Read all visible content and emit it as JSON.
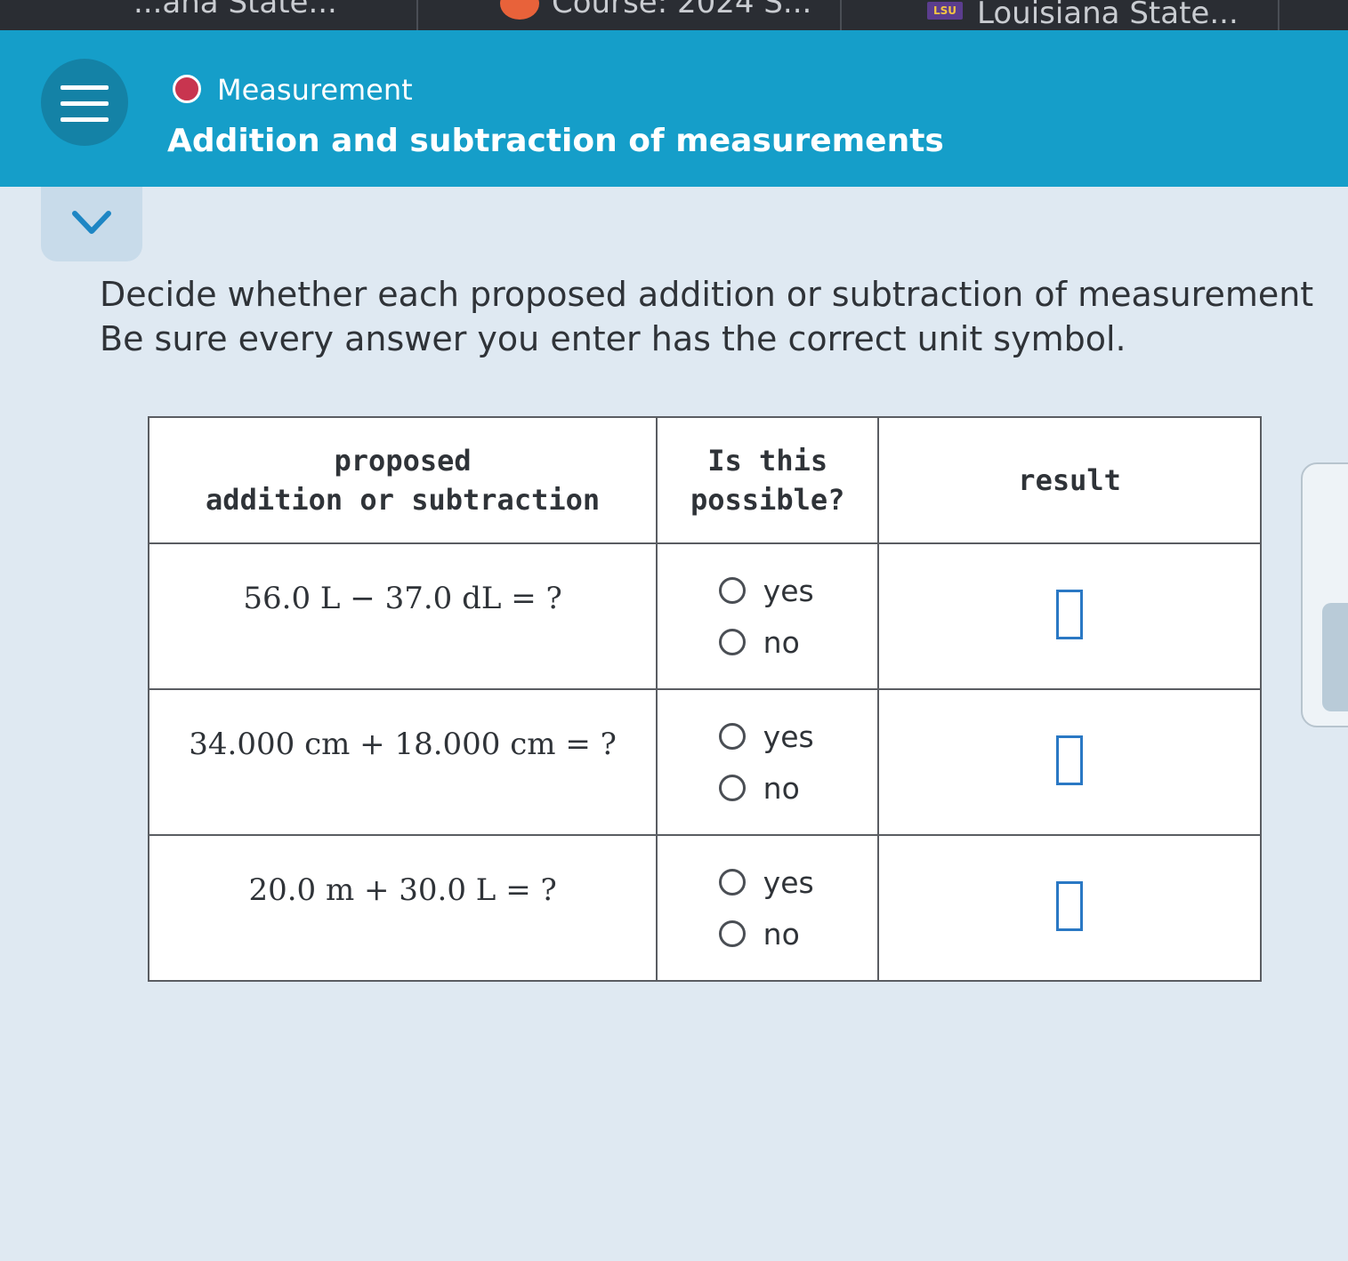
{
  "browser_tabs": [
    {
      "label": "...ana State..."
    },
    {
      "label": "Course: 2024 S..."
    },
    {
      "label": "Louisiana State...",
      "icon_text": "LSU"
    }
  ],
  "header": {
    "topic": "Measurement",
    "title": "Addition and subtraction of measurements"
  },
  "instructions": {
    "line1": "Decide whether each proposed addition or subtraction of measurement",
    "line2": "Be sure every answer you enter has the correct unit symbol."
  },
  "table": {
    "headers": {
      "col1_line1": "proposed",
      "col1_line2": "addition or subtraction",
      "col2_line1": "Is this",
      "col2_line2": "possible?",
      "col3": "result"
    },
    "rows": [
      {
        "expression": "56.0 L − 37.0 dL = ?",
        "option_yes": "yes",
        "option_no": "no"
      },
      {
        "expression": "34.000 cm + 18.000 cm = ?",
        "option_yes": "yes",
        "option_no": "no"
      },
      {
        "expression": "20.0 m + 30.0 L = ?",
        "option_yes": "yes",
        "option_no": "no"
      }
    ]
  },
  "colors": {
    "header_bg": "#159ec9",
    "topic_dot": "#c8354f",
    "answer_box_border": "#2a78c4"
  }
}
